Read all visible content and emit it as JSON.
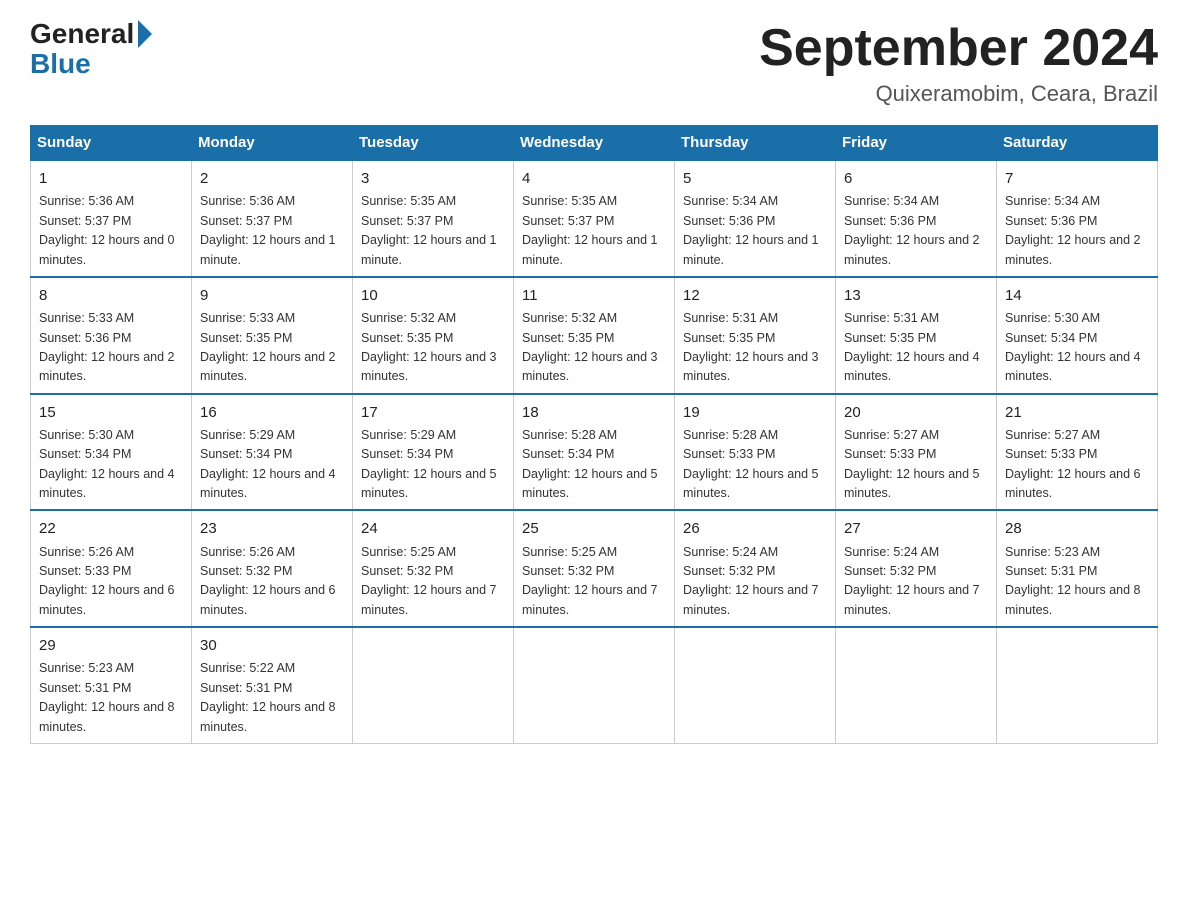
{
  "header": {
    "logo_general": "General",
    "logo_blue": "Blue",
    "month_title": "September 2024",
    "location": "Quixeramobim, Ceara, Brazil"
  },
  "weekdays": [
    "Sunday",
    "Monday",
    "Tuesday",
    "Wednesday",
    "Thursday",
    "Friday",
    "Saturday"
  ],
  "weeks": [
    [
      {
        "day": "1",
        "sunrise": "5:36 AM",
        "sunset": "5:37 PM",
        "daylight": "12 hours and 0 minutes."
      },
      {
        "day": "2",
        "sunrise": "5:36 AM",
        "sunset": "5:37 PM",
        "daylight": "12 hours and 1 minute."
      },
      {
        "day": "3",
        "sunrise": "5:35 AM",
        "sunset": "5:37 PM",
        "daylight": "12 hours and 1 minute."
      },
      {
        "day": "4",
        "sunrise": "5:35 AM",
        "sunset": "5:37 PM",
        "daylight": "12 hours and 1 minute."
      },
      {
        "day": "5",
        "sunrise": "5:34 AM",
        "sunset": "5:36 PM",
        "daylight": "12 hours and 1 minute."
      },
      {
        "day": "6",
        "sunrise": "5:34 AM",
        "sunset": "5:36 PM",
        "daylight": "12 hours and 2 minutes."
      },
      {
        "day": "7",
        "sunrise": "5:34 AM",
        "sunset": "5:36 PM",
        "daylight": "12 hours and 2 minutes."
      }
    ],
    [
      {
        "day": "8",
        "sunrise": "5:33 AM",
        "sunset": "5:36 PM",
        "daylight": "12 hours and 2 minutes."
      },
      {
        "day": "9",
        "sunrise": "5:33 AM",
        "sunset": "5:35 PM",
        "daylight": "12 hours and 2 minutes."
      },
      {
        "day": "10",
        "sunrise": "5:32 AM",
        "sunset": "5:35 PM",
        "daylight": "12 hours and 3 minutes."
      },
      {
        "day": "11",
        "sunrise": "5:32 AM",
        "sunset": "5:35 PM",
        "daylight": "12 hours and 3 minutes."
      },
      {
        "day": "12",
        "sunrise": "5:31 AM",
        "sunset": "5:35 PM",
        "daylight": "12 hours and 3 minutes."
      },
      {
        "day": "13",
        "sunrise": "5:31 AM",
        "sunset": "5:35 PM",
        "daylight": "12 hours and 4 minutes."
      },
      {
        "day": "14",
        "sunrise": "5:30 AM",
        "sunset": "5:34 PM",
        "daylight": "12 hours and 4 minutes."
      }
    ],
    [
      {
        "day": "15",
        "sunrise": "5:30 AM",
        "sunset": "5:34 PM",
        "daylight": "12 hours and 4 minutes."
      },
      {
        "day": "16",
        "sunrise": "5:29 AM",
        "sunset": "5:34 PM",
        "daylight": "12 hours and 4 minutes."
      },
      {
        "day": "17",
        "sunrise": "5:29 AM",
        "sunset": "5:34 PM",
        "daylight": "12 hours and 5 minutes."
      },
      {
        "day": "18",
        "sunrise": "5:28 AM",
        "sunset": "5:34 PM",
        "daylight": "12 hours and 5 minutes."
      },
      {
        "day": "19",
        "sunrise": "5:28 AM",
        "sunset": "5:33 PM",
        "daylight": "12 hours and 5 minutes."
      },
      {
        "day": "20",
        "sunrise": "5:27 AM",
        "sunset": "5:33 PM",
        "daylight": "12 hours and 5 minutes."
      },
      {
        "day": "21",
        "sunrise": "5:27 AM",
        "sunset": "5:33 PM",
        "daylight": "12 hours and 6 minutes."
      }
    ],
    [
      {
        "day": "22",
        "sunrise": "5:26 AM",
        "sunset": "5:33 PM",
        "daylight": "12 hours and 6 minutes."
      },
      {
        "day": "23",
        "sunrise": "5:26 AM",
        "sunset": "5:32 PM",
        "daylight": "12 hours and 6 minutes."
      },
      {
        "day": "24",
        "sunrise": "5:25 AM",
        "sunset": "5:32 PM",
        "daylight": "12 hours and 7 minutes."
      },
      {
        "day": "25",
        "sunrise": "5:25 AM",
        "sunset": "5:32 PM",
        "daylight": "12 hours and 7 minutes."
      },
      {
        "day": "26",
        "sunrise": "5:24 AM",
        "sunset": "5:32 PM",
        "daylight": "12 hours and 7 minutes."
      },
      {
        "day": "27",
        "sunrise": "5:24 AM",
        "sunset": "5:32 PM",
        "daylight": "12 hours and 7 minutes."
      },
      {
        "day": "28",
        "sunrise": "5:23 AM",
        "sunset": "5:31 PM",
        "daylight": "12 hours and 8 minutes."
      }
    ],
    [
      {
        "day": "29",
        "sunrise": "5:23 AM",
        "sunset": "5:31 PM",
        "daylight": "12 hours and 8 minutes."
      },
      {
        "day": "30",
        "sunrise": "5:22 AM",
        "sunset": "5:31 PM",
        "daylight": "12 hours and 8 minutes."
      },
      null,
      null,
      null,
      null,
      null
    ]
  ]
}
